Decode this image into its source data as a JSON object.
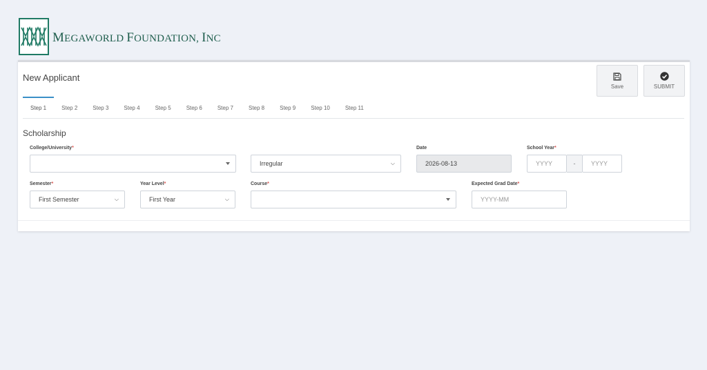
{
  "header": {
    "brand_m": "M",
    "brand_egaworld": "EGAWORLD ",
    "brand_f": "F",
    "brand_oundation": "OUNDATION, ",
    "brand_i": "I",
    "brand_nc": "NC",
    "brand_color": "#1f5e4d",
    "logo_icon": "megaworld-logo"
  },
  "card": {
    "title": "New Applicant",
    "save_label": "Save",
    "submit_label": "SUBMIT"
  },
  "tabs": [
    "Step 1",
    "Step 2",
    "Step 3",
    "Step 4",
    "Step 5",
    "Step 6",
    "Step 7",
    "Step 8",
    "Step 9",
    "Step 10",
    "Step 11"
  ],
  "active_tab": "Step 1",
  "form": {
    "section_title": "Scholarship",
    "college_label": "College/University",
    "college_value": "",
    "status_value": "Irregular",
    "date_label": "Date",
    "date_value": "2026-08-13",
    "school_year_label": "School Year",
    "school_year_start_placeholder": "YYYY",
    "school_year_separator": "-",
    "school_year_end_placeholder": "YYYY",
    "semester_label": "Semester",
    "semester_value": "First Semester",
    "year_level_label": "Year Level",
    "year_level_value": "First Year",
    "course_label": "Course",
    "course_value": "",
    "grad_date_label": "Expected Grad Date",
    "grad_date_placeholder": "YYYY-MM",
    "required_marker": "*"
  },
  "colors": {
    "accent": "#3a8fc7",
    "required": "#d9534f",
    "logo": "#1f7a64"
  }
}
